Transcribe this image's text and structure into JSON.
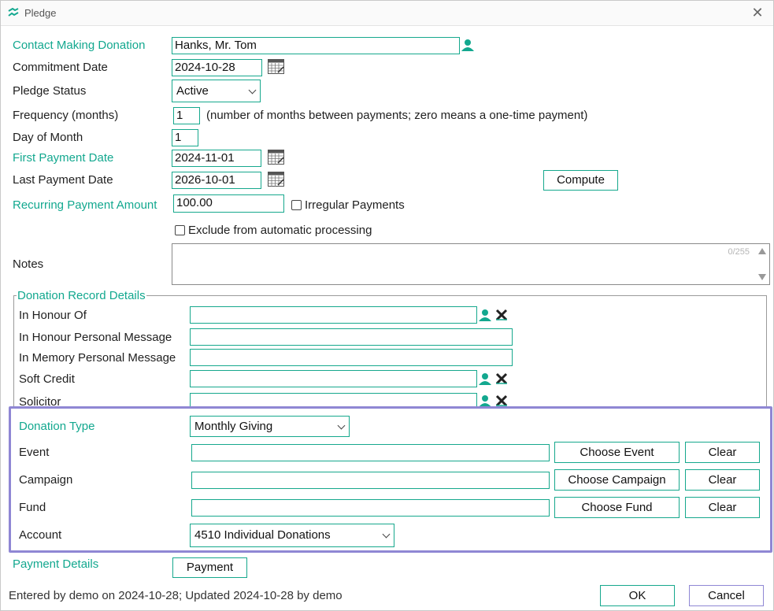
{
  "window": {
    "title": "Pledge"
  },
  "form": {
    "contact": {
      "label": "Contact Making Donation",
      "value": "Hanks, Mr. Tom"
    },
    "commitment_date": {
      "label": "Commitment Date",
      "value": "2024-10-28"
    },
    "pledge_status": {
      "label": "Pledge Status",
      "value": "Active"
    },
    "frequency": {
      "label": "Frequency (months)",
      "value": "1",
      "hint": "(number of months between payments; zero means a one-time payment)"
    },
    "day_of_month": {
      "label": "Day of Month",
      "value": "1"
    },
    "first_payment_date": {
      "label": "First Payment Date",
      "value": "2024-11-01"
    },
    "last_payment_date": {
      "label": "Last Payment Date",
      "value": "2026-10-01"
    },
    "compute_button": "Compute",
    "recurring_amount": {
      "label": "Recurring Payment Amount",
      "value": "100.00"
    },
    "irregular_payments": {
      "label": "Irregular Payments",
      "checked": false
    },
    "exclude_auto": {
      "label": "Exclude from automatic processing",
      "checked": false
    },
    "notes": {
      "label": "Notes",
      "value": "",
      "counter": "0/255"
    }
  },
  "donation_record": {
    "legend": "Donation Record Details",
    "in_honour_of": {
      "label": "In Honour Of",
      "value": ""
    },
    "in_honour_message": {
      "label": "In Honour Personal Message",
      "value": ""
    },
    "in_memory_message": {
      "label": "In Memory Personal Message",
      "value": ""
    },
    "soft_credit": {
      "label": "Soft Credit",
      "value": ""
    },
    "solicitor": {
      "label": "Solicitor",
      "value": ""
    }
  },
  "donation_details": {
    "donation_type": {
      "label": "Donation Type",
      "value": "Monthly Giving"
    },
    "event": {
      "label": "Event",
      "value": "",
      "choose": "Choose Event",
      "clear": "Clear"
    },
    "campaign": {
      "label": "Campaign",
      "value": "",
      "choose": "Choose Campaign",
      "clear": "Clear"
    },
    "fund": {
      "label": "Fund",
      "value": "",
      "choose": "Choose Fund",
      "clear": "Clear"
    },
    "account": {
      "label": "Account",
      "value": "4510 Individual Donations"
    }
  },
  "payment": {
    "label": "Payment Details",
    "button": "Payment"
  },
  "footer": {
    "status": "Entered by demo on 2024-10-28; Updated 2024-10-28 by demo",
    "ok": "OK",
    "cancel": "Cancel"
  },
  "colors": {
    "accent": "#13a88f",
    "highlight": "#8f87d4",
    "cancel_border": "#8f87d4"
  },
  "icons": [
    "app-logo-icon",
    "close-icon",
    "calendar-icon",
    "person-icon",
    "clear-x-icon",
    "chevron-down-icon"
  ]
}
